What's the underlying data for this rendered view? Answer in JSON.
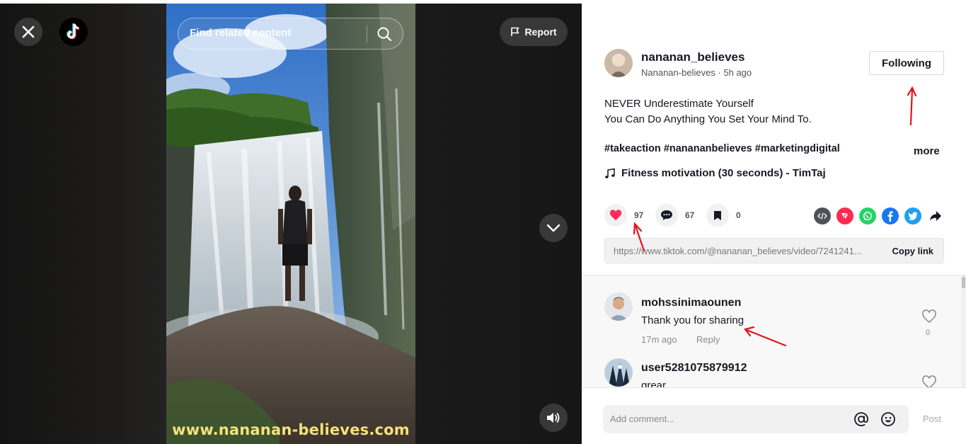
{
  "search": {
    "placeholder": "Find related content"
  },
  "video": {
    "watermark": "www.nananan-believes.com"
  },
  "controls": {
    "report_label": "Report"
  },
  "post": {
    "username": "nananan_believes",
    "display_name": "Nananan-believes",
    "time_ago": "5h ago",
    "follow_label": "Following",
    "description_lines": [
      "NEVER Underestimate Yourself",
      "You Can Do Anything You Set Your Mind To."
    ],
    "hashtags": "#takeaction #nanananbelieves #marketingdigital",
    "more_label": "more",
    "music": "Fitness motivation (30 seconds) - TimTaj",
    "likes": "97",
    "comments": "67",
    "saves": "0",
    "link_url": "https://www.tiktok.com/@nananan_believes/video/7241241...",
    "copy_label": "Copy link"
  },
  "share_icons": [
    "embed-icon",
    "send-icon",
    "whatsapp-icon",
    "facebook-icon",
    "twitter-icon",
    "share-arrow-icon"
  ],
  "comments": [
    {
      "user": "mohssinimaounen",
      "text": "Thank you for sharing",
      "time": "17m ago",
      "reply": "Reply",
      "likes": "0"
    },
    {
      "user": "user5281075879912",
      "text": "grear"
    }
  ],
  "comment_box": {
    "placeholder": "Add comment...",
    "post_label": "Post"
  },
  "colors": {
    "like_red": "#fe2c55",
    "annotation_red": "#e0141e",
    "text_primary": "#161823",
    "watermark_yellow": "#f5e17a"
  }
}
